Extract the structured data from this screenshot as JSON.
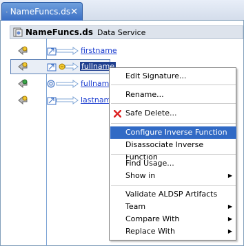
{
  "tab": {
    "title": "NameFuncs.ds",
    "close": "✕"
  },
  "header": {
    "title": "NameFuncs.ds",
    "subtitle": "Data Service"
  },
  "functions": [
    "firstname",
    "fullname",
    "fullname",
    "lastname"
  ],
  "menu": {
    "edit_signature": "Edit Signature...",
    "rename": "Rename...",
    "safe_delete": "Safe Delete...",
    "configure_inverse": "Configure Inverse Function",
    "disassociate_inverse": "Disassociate Inverse Function",
    "find_usage": "Find Usage...",
    "show_in": "Show in",
    "validate": "Validate ALDSP Artifacts",
    "team": "Team",
    "compare_with": "Compare With",
    "replace_with": "Replace With",
    "submenu_arrow": "▶"
  },
  "colors": {
    "selected_menu": "#316ac5",
    "link": "#1a3ccf",
    "tab": "#3a6ec4"
  }
}
